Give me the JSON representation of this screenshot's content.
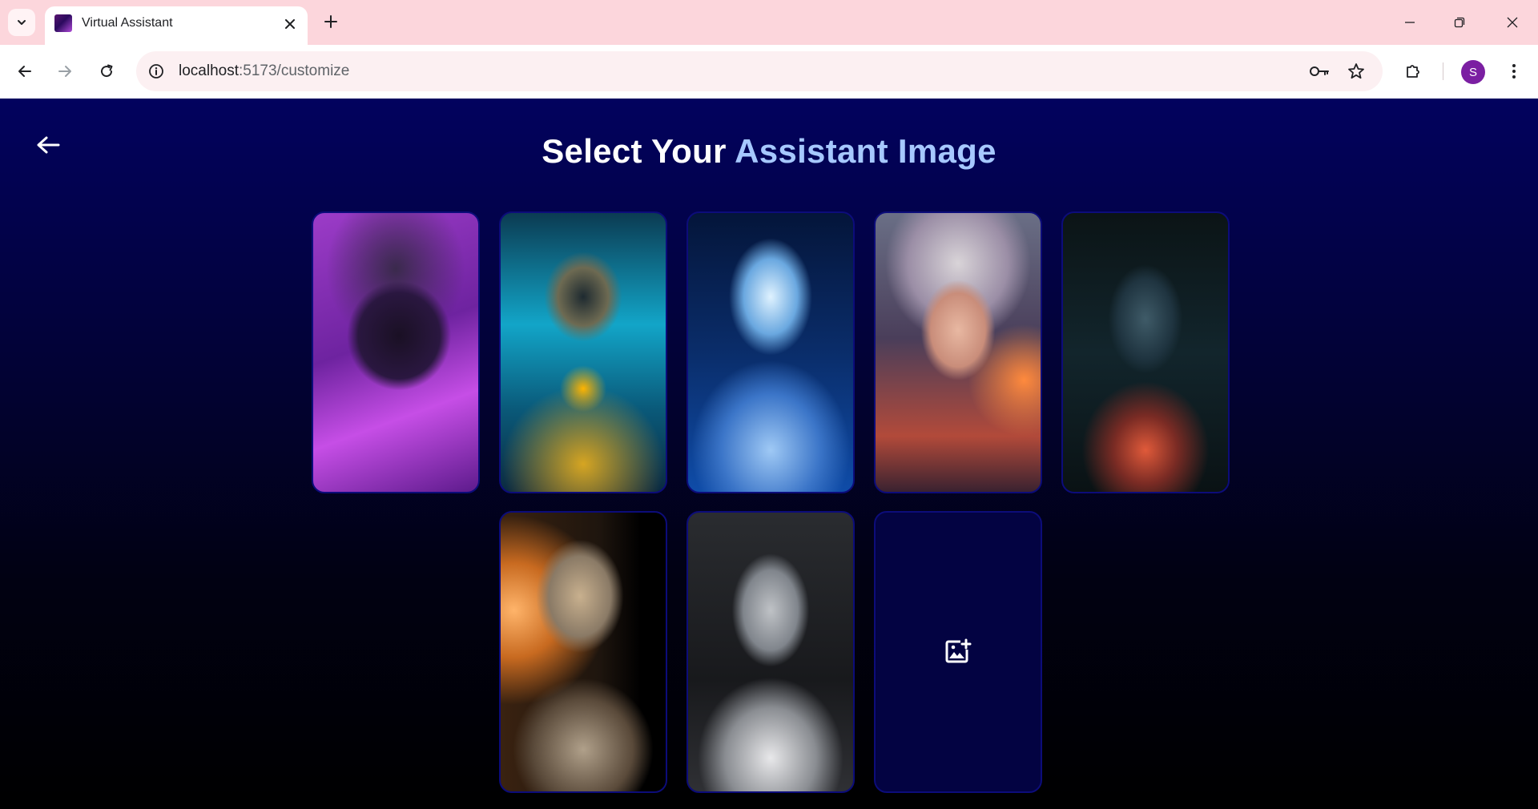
{
  "browser": {
    "tab_title": "Virtual Assistant",
    "url_host": "localhost",
    "url_path": ":5173/customize",
    "profile_initial": "S"
  },
  "page": {
    "title_part1": "Select Your ",
    "title_part2": "Assistant Image",
    "accent_color": "#a6c8ff",
    "cards": [
      {
        "name": "purple-chrome-robot"
      },
      {
        "name": "gold-cyan-robot"
      },
      {
        "name": "blue-glowing-android"
      },
      {
        "name": "cyborg-woman-neon"
      },
      {
        "name": "cyborg-woman-dark"
      },
      {
        "name": "gold-android-woman"
      },
      {
        "name": "white-android-headphones"
      }
    ],
    "upload_icon": "image-add-icon"
  }
}
